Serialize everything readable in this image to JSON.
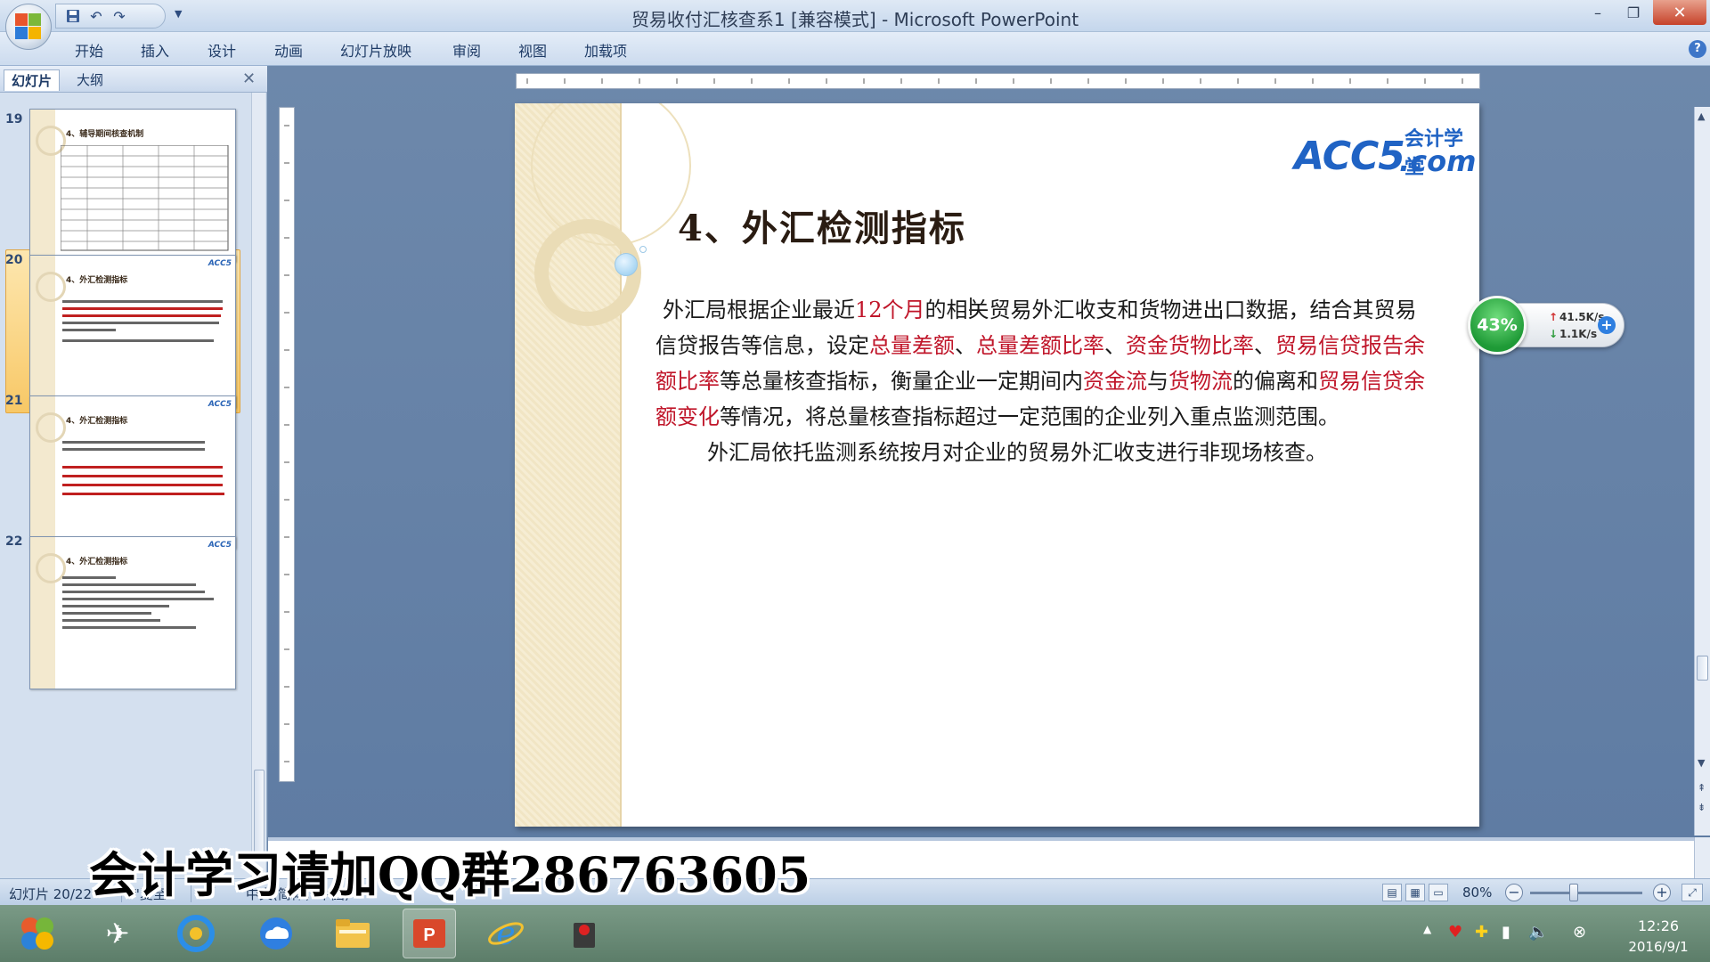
{
  "window": {
    "title": "贸易收付汇核查系1 [兼容模式] - Microsoft PowerPoint",
    "minimize_glyph": "–",
    "restore_glyph": "❐",
    "close_glyph": "✕"
  },
  "quick_access": {
    "icons": [
      "save-icon",
      "undo-icon",
      "redo-icon",
      "customize-icon"
    ]
  },
  "ribbon": {
    "tabs": [
      "开始",
      "插入",
      "设计",
      "动画",
      "幻灯片放映",
      "审阅",
      "视图",
      "加载项"
    ],
    "help_glyph": "?"
  },
  "left_panel": {
    "tab_slides": "幻灯片",
    "tab_outline": "大纲",
    "close_glyph": "✕",
    "thumbnails": [
      {
        "number": "19",
        "title": "4、辅导期间核查机制"
      },
      {
        "number": "20",
        "title": "4、外汇检测指标"
      },
      {
        "number": "21",
        "title": "4、外汇检测指标"
      },
      {
        "number": "22",
        "title": "4、外汇检测指标"
      }
    ],
    "selected_number": "20"
  },
  "slide": {
    "logo_acc": "ACC5",
    "logo_cn": "会计学堂",
    "logo_com": ".com",
    "title": "4、外汇检测指标",
    "para1": {
      "t1": "外汇局根据企业最近",
      "r1": "12个月",
      "t2": "的相关贸易外汇收支和货物进出口数据，结合其贸易信贷报告等信息，设定",
      "r2": "总量差额",
      "t3": "、",
      "r3": "总量差额比率",
      "t4": "、",
      "r4": "资金货物比率",
      "t5": "、",
      "r5": "贸易信贷报告余额比率",
      "t6": "等总量核查指标，衡量企业一定期间内",
      "r6": "资金流",
      "t7": "与",
      "r7": "货物流",
      "t8": "的偏离和",
      "r8": "贸易信贷余额变化",
      "t9": "等情况，将总量核查指标超过一定范围的企业列入重点监测范围。"
    },
    "para2": "外汇局依托监测系统按月对企业的贸易外汇收支进行非现场核查。",
    "accent_red": "#c0162a"
  },
  "watermark": "会计学习请加QQ群286763605",
  "net_widget": {
    "percent": "43%",
    "upload": "41.5K/s",
    "download": "1.1K/s",
    "plus_glyph": "+"
  },
  "status_bar": {
    "slide_info": "幻灯片 20/22",
    "theme": "\"夏至\"",
    "language": "中文(简体，中国)",
    "zoom": "80%",
    "zoom_minus": "−",
    "zoom_plus": "+"
  },
  "taskbar": {
    "apps": [
      "start-icon",
      "pin-app-icon",
      "browser-360-icon",
      "cloud-app-icon",
      "file-explorer-icon",
      "powerpoint-icon",
      "ie-icon",
      "recorder-icon"
    ],
    "clock_time": "12:26",
    "clock_date": "2016/9/1"
  }
}
